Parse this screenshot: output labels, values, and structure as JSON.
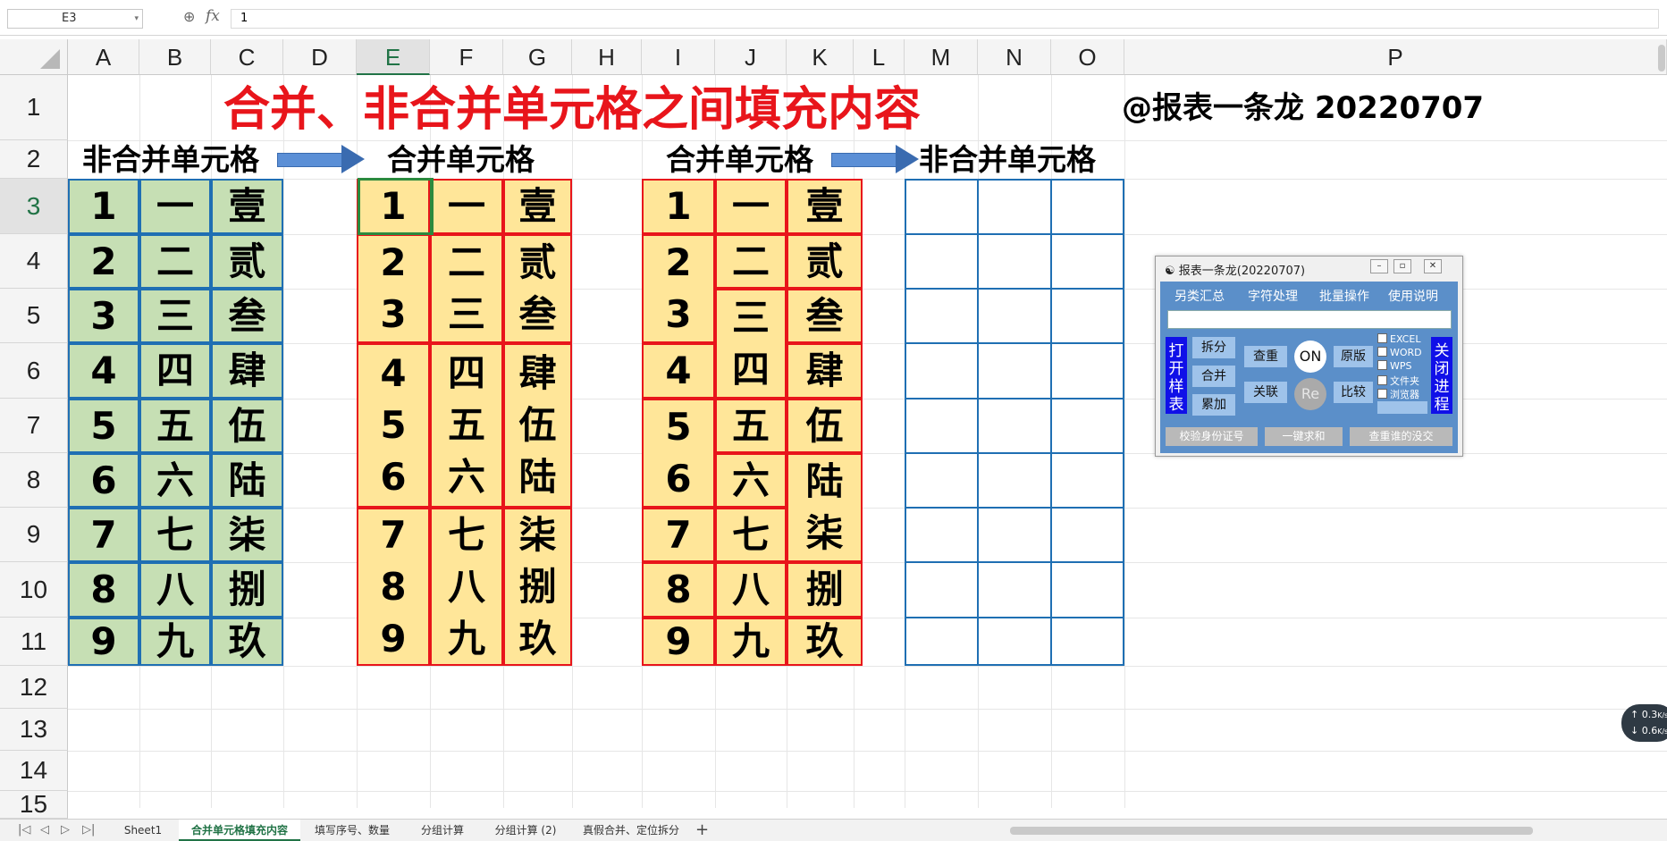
{
  "formula_bar": {
    "name_box": "E3",
    "fx_label": "fx",
    "formula": "1"
  },
  "columns": [
    {
      "id": "A"
    },
    {
      "id": "B"
    },
    {
      "id": "C"
    },
    {
      "id": "D"
    },
    {
      "id": "E"
    },
    {
      "id": "F"
    },
    {
      "id": "G"
    },
    {
      "id": "H"
    },
    {
      "id": "I"
    },
    {
      "id": "J"
    },
    {
      "id": "K"
    },
    {
      "id": "L"
    },
    {
      "id": "M"
    },
    {
      "id": "N"
    },
    {
      "id": "O"
    },
    {
      "id": "P"
    }
  ],
  "rows": [
    "1",
    "2",
    "3",
    "4",
    "5",
    "6",
    "7",
    "8",
    "9",
    "10",
    "11",
    "12",
    "13",
    "14",
    "15"
  ],
  "selected_column": "E",
  "selected_row": "3",
  "sheet": {
    "title": "合并、非合并单元格之间填充内容",
    "author_note": "@报表一条龙 20220707",
    "labels": {
      "non_merged_1": "非合并单元格",
      "merged_1": "合并单元格",
      "merged_2": "合并单元格",
      "non_merged_2": "非合并单元格"
    }
  },
  "table1": {
    "rows": [
      [
        "1",
        "一",
        "壹"
      ],
      [
        "2",
        "二",
        "贰"
      ],
      [
        "3",
        "三",
        "叁"
      ],
      [
        "4",
        "四",
        "肆"
      ],
      [
        "5",
        "五",
        "伍"
      ],
      [
        "6",
        "六",
        "陆"
      ],
      [
        "7",
        "七",
        "柒"
      ],
      [
        "8",
        "八",
        "捌"
      ],
      [
        "9",
        "九",
        "玖"
      ]
    ]
  },
  "table2": {
    "groups": [
      {
        "col1": [
          "1"
        ],
        "col2": [
          "一"
        ],
        "col3": [
          "壹"
        ]
      },
      {
        "col1": [
          "2",
          "3"
        ],
        "col2": [
          "二",
          "三"
        ],
        "col3": [
          "贰",
          "叁"
        ]
      },
      {
        "col1": [
          "4",
          "5",
          "6"
        ],
        "col2": [
          "四",
          "五",
          "六"
        ],
        "col3": [
          "肆",
          "伍",
          "陆"
        ]
      },
      {
        "col1": [
          "7",
          "8",
          "9"
        ],
        "col2": [
          "七",
          "八",
          "九"
        ],
        "col3": [
          "柒",
          "捌",
          "玖"
        ]
      }
    ]
  },
  "table3": {
    "col1": [
      "1",
      "2",
      "3",
      "4",
      "5",
      "6",
      "7",
      "8",
      "9"
    ],
    "col2": [
      "一",
      "二",
      "三",
      "四",
      "五",
      "六",
      "七",
      "八",
      "九"
    ],
    "col3": [
      "壹",
      "贰",
      "叁",
      "肆",
      "伍",
      "陆",
      "柒",
      "捌",
      "玖"
    ]
  },
  "panel": {
    "title": "报表一条龙(20220707)",
    "menu": [
      "另类汇总",
      "字符处理",
      "批量操作",
      "使用说明"
    ],
    "left_side": "打开样表",
    "right_side": "关闭进程",
    "buttons": {
      "split": "拆分",
      "merge": "合并",
      "accumulate": "累加",
      "dedupe": "查重",
      "link": "关联",
      "on": "ON",
      "re": "Re",
      "original": "原版",
      "compare": "比较"
    },
    "checkboxes": [
      "EXCEL",
      "WORD",
      "WPS",
      "文件夹",
      "浏览器"
    ],
    "bottom": [
      "校验身份证号",
      "一键求和",
      "查重谁的没交"
    ]
  },
  "speed": {
    "up": "0.3",
    "down": "0.6",
    "unit": "K/s"
  },
  "tabs": [
    "Sheet1",
    "合并单元格填充内容",
    "填写序号、数量",
    "分组计算",
    "分组计算 (2)",
    "真假合并、定位拆分"
  ],
  "active_tab": "合并单元格填充内容",
  "add_tab": "+"
}
